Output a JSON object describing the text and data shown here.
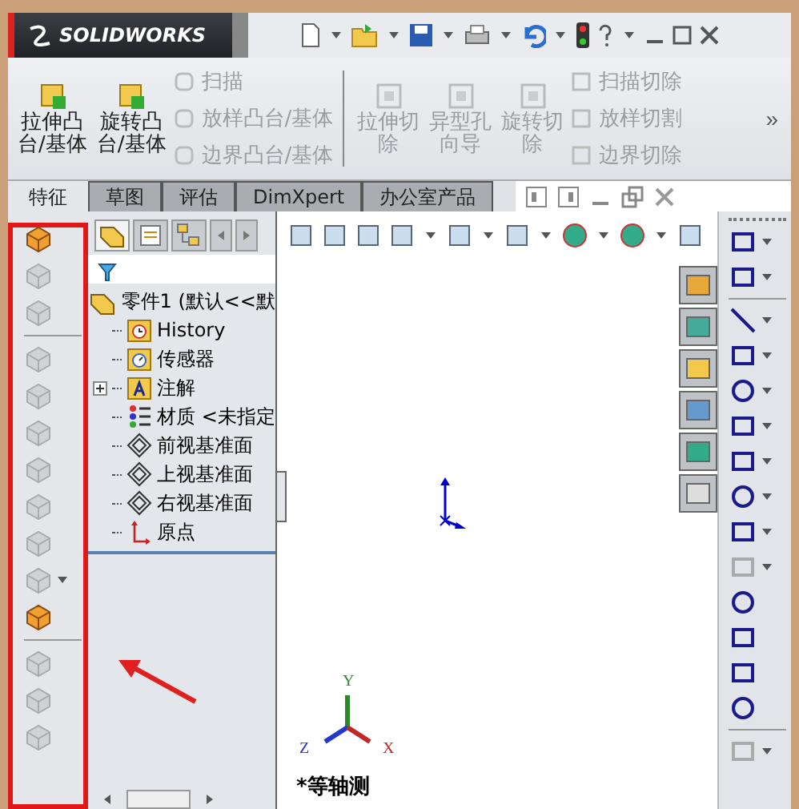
{
  "app": {
    "logo": "SOLIDWORKS"
  },
  "command_manager": {
    "large_left": [
      {
        "lines": [
          "拉伸凸",
          "台/基体"
        ],
        "disabled": false
      },
      {
        "lines": [
          "旋转凸",
          "台/基体"
        ],
        "disabled": false
      }
    ],
    "small_left": [
      {
        "label": "扫描",
        "disabled": true
      },
      {
        "label": "放样凸台/基体",
        "disabled": true
      },
      {
        "label": "边界凸台/基体",
        "disabled": true
      }
    ],
    "large_right": [
      {
        "lines": [
          "拉伸切",
          "除"
        ],
        "disabled": true
      },
      {
        "lines": [
          "异型孔",
          "向导"
        ],
        "disabled": true
      },
      {
        "lines": [
          "旋转切",
          "除"
        ],
        "disabled": true
      }
    ],
    "small_right": [
      {
        "label": "扫描切除",
        "disabled": true
      },
      {
        "label": "放样切割",
        "disabled": true
      },
      {
        "label": "边界切除",
        "disabled": true
      }
    ],
    "overflow": "»"
  },
  "tabs": [
    {
      "label": "特征",
      "selected": true
    },
    {
      "label": "草图",
      "selected": false
    },
    {
      "label": "评估",
      "selected": false
    },
    {
      "label": "DimXpert",
      "selected": false
    },
    {
      "label": "办公室产品",
      "selected": false
    }
  ],
  "feature_toolbar": [
    [
      {
        "disabled": false
      },
      {
        "disabled": true
      },
      {
        "disabled": true
      }
    ],
    [
      {
        "disabled": true
      },
      {
        "disabled": true
      },
      {
        "disabled": true
      },
      {
        "disabled": true
      },
      {
        "disabled": true
      },
      {
        "disabled": true
      },
      {
        "disabled": true
      },
      {
        "disabled": false
      }
    ],
    [
      {
        "disabled": true
      },
      {
        "disabled": true
      },
      {
        "disabled": true
      }
    ]
  ],
  "tree": {
    "root": "零件1 (默认<<默",
    "items": [
      {
        "label": "History",
        "kind": "history"
      },
      {
        "label": "传感器",
        "kind": "sensor"
      },
      {
        "label": "注解",
        "kind": "annotation",
        "expanded": false
      },
      {
        "label": "材质 <未指定",
        "kind": "material"
      },
      {
        "label": "前视基准面",
        "kind": "plane"
      },
      {
        "label": "上视基准面",
        "kind": "plane"
      },
      {
        "label": "右视基准面",
        "kind": "plane"
      },
      {
        "label": "原点",
        "kind": "origin"
      }
    ]
  },
  "triad": {
    "y": "Y",
    "z": "Z",
    "x": "X"
  },
  "view_name": "*等轴测",
  "sketch_toolbar": [
    [
      {
        "disabled": false
      },
      {
        "disabled": false
      }
    ],
    [
      {
        "disabled": false
      },
      {
        "disabled": false
      },
      {
        "disabled": false
      },
      {
        "disabled": false
      },
      {
        "disabled": false
      },
      {
        "disabled": false
      },
      {
        "disabled": false
      },
      {
        "disabled": true
      },
      {
        "disabled": false
      },
      {
        "disabled": false
      },
      {
        "disabled": false
      },
      {
        "disabled": false
      }
    ],
    [
      {
        "disabled": true
      }
    ]
  ]
}
